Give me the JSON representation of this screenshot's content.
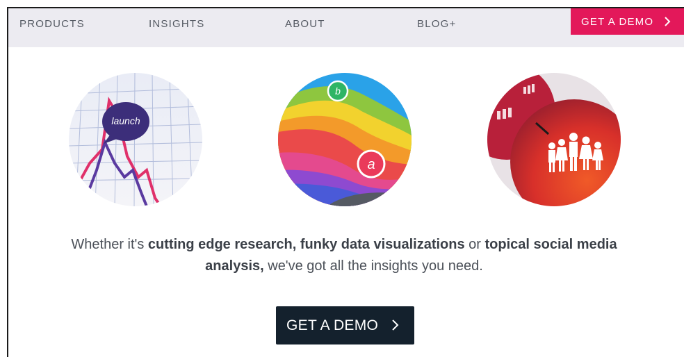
{
  "nav": {
    "items": [
      "PRODUCTS",
      "INSIGHTS",
      "ABOUT",
      "BLOG+"
    ],
    "cta_label": "GET A DEMO"
  },
  "illustrations": {
    "launch_label": "launch",
    "marker_b": "b",
    "marker_a": "a"
  },
  "tagline": {
    "p1": "Whether it's ",
    "b1": "cutting edge research, funky data visualizations",
    "p2": " or ",
    "b2": "topical social media analysis,",
    "p3": " we've got all the insights you need."
  },
  "main_cta": {
    "label": "GET A DEMO"
  },
  "colors": {
    "nav_bg": "#ecebf1",
    "cta_pink": "#e3185a",
    "cta_dark": "#14212d",
    "text": "#4b5058"
  }
}
